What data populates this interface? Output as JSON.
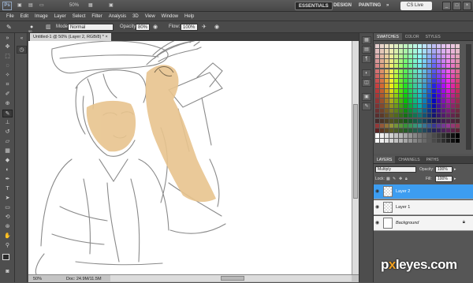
{
  "app": {
    "logo": "Ps",
    "zoom": "50%",
    "workspaces": [
      "ESSENTIALS",
      "DESIGN",
      "PAINTING"
    ],
    "more": "»",
    "cslive": "CS Live",
    "win_minimize": "_",
    "win_maximize": "□",
    "win_close": "×"
  },
  "menu": [
    "File",
    "Edit",
    "Image",
    "Layer",
    "Select",
    "Filter",
    "Analysis",
    "3D",
    "View",
    "Window",
    "Help"
  ],
  "options": {
    "brush_size": "90",
    "mode_label": "Mode:",
    "mode_value": "Normal",
    "opacity_label": "Opacity:",
    "opacity_value": "80%",
    "flow_label": "Flow:",
    "flow_value": "100%"
  },
  "document": {
    "tab_title": "Untitled-1 @ 50% (Layer 2, RGB/8) *",
    "tab_close": "×",
    "zoom": "50%",
    "doc_info": "Doc: 24.9M/11.5M"
  },
  "swatches_panel": {
    "tabs": [
      "SWATCHES",
      "COLOR",
      "STYLES"
    ],
    "active_tab": "SWATCHES"
  },
  "layers_panel": {
    "tabs": [
      "LAYERS",
      "CHANNELS",
      "PATHS"
    ],
    "active_tab": "LAYERS",
    "blend_mode": "Multiply",
    "opacity_label": "Opacity:",
    "opacity_value": "100%",
    "lock_label": "Lock:",
    "fill_label": "Fill:",
    "fill_value": "100%",
    "layers": [
      {
        "name": "Layer 2",
        "selected": true,
        "visible": true
      },
      {
        "name": "Layer 1",
        "selected": false,
        "visible": true
      },
      {
        "name": "Background",
        "selected": false,
        "visible": true,
        "locked": true
      }
    ]
  },
  "watermark": {
    "pre": "p",
    "x": "x",
    "post": "leyes.com"
  },
  "colors": {
    "accent": "#3d9df0",
    "foreground": "#2a2a2a",
    "background": "#b05a5a",
    "skin": "#e8c48e"
  }
}
